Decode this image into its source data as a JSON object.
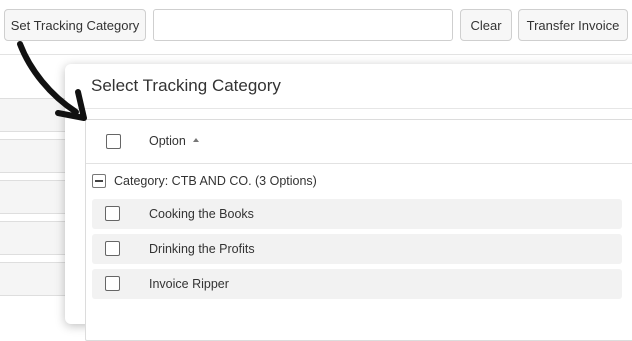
{
  "toolbar": {
    "set_tracking_label": "Set Tracking Category",
    "search_value": "",
    "clear_label": "Clear",
    "transfer_label": "Transfer Invoice"
  },
  "modal": {
    "title": "Select Tracking Category",
    "column_header": "Option",
    "group": {
      "label": "Category: CTB AND CO. (3 Options)"
    },
    "options": [
      {
        "label": "Cooking the Books",
        "checked": false
      },
      {
        "label": "Drinking the Profits",
        "checked": false
      },
      {
        "label": "Invoice Ripper",
        "checked": false
      }
    ]
  }
}
